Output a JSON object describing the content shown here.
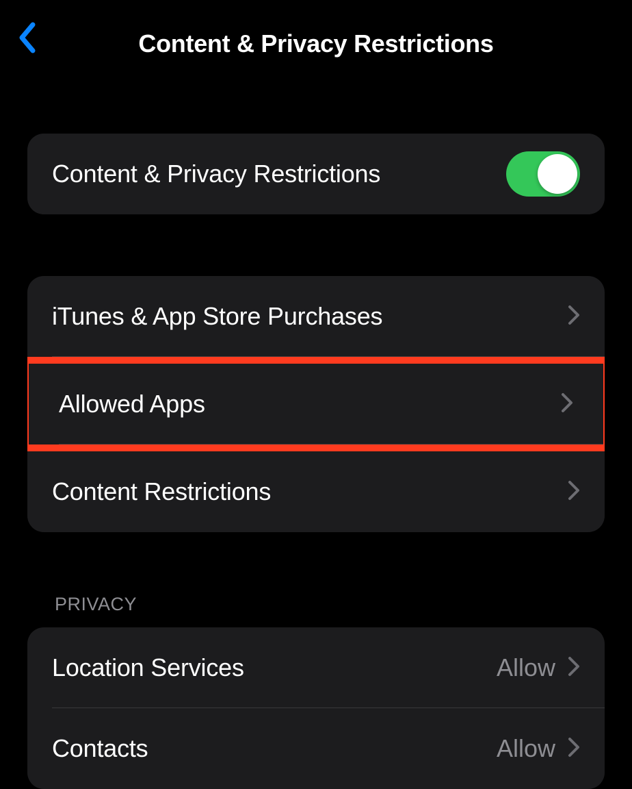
{
  "header": {
    "title": "Content & Privacy Restrictions"
  },
  "toggle_section": {
    "label": "Content & Privacy Restrictions",
    "enabled": true
  },
  "content_section": {
    "items": [
      {
        "label": "iTunes & App Store Purchases"
      },
      {
        "label": "Allowed Apps"
      },
      {
        "label": "Content Restrictions"
      }
    ]
  },
  "privacy_section": {
    "header": "PRIVACY",
    "items": [
      {
        "label": "Location Services",
        "value": "Allow"
      },
      {
        "label": "Contacts",
        "value": "Allow"
      }
    ]
  }
}
